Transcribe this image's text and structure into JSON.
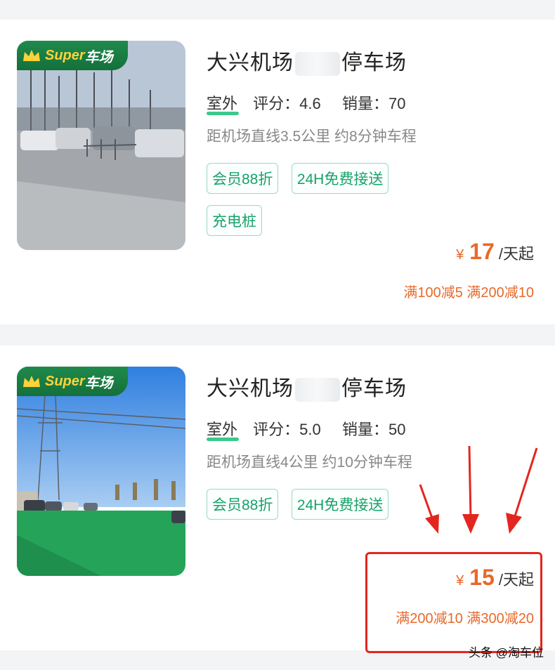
{
  "listings": [
    {
      "badge_brand": "Super",
      "badge_suffix": "车场",
      "title_prefix": "大兴机场",
      "title_suffix": "停车场",
      "type": "室外",
      "rating_label": "评分：",
      "rating": "4.6",
      "sales_label": "销量：",
      "sales": "70",
      "distance": "距机场直线3.5公里 约8分钟车程",
      "tags": [
        "会员88折",
        "24H免费接送",
        "充电桩"
      ],
      "currency": "¥",
      "price": "17",
      "price_unit": "/天起",
      "discount": "满100减5 满200减10"
    },
    {
      "badge_brand": "Super",
      "badge_suffix": "车场",
      "title_prefix": "大兴机场",
      "title_suffix": "停车场",
      "type": "室外",
      "rating_label": "评分：",
      "rating": "5.0",
      "sales_label": "销量：",
      "sales": "50",
      "distance": "距机场直线4公里 约10分钟车程",
      "tags": [
        "会员88折",
        "24H免费接送"
      ],
      "currency": "¥",
      "price": "15",
      "price_unit": "/天起",
      "discount": "满200减10 满300减20"
    }
  ],
  "watermark": "头条 @淘车位",
  "colors": {
    "accent": "#e8692a",
    "tag_green": "#17a26b",
    "badge_green": "#1f8a4c",
    "highlight_red": "#e3261f"
  },
  "icons": [
    "crown-icon",
    "down-arrow-icon"
  ]
}
